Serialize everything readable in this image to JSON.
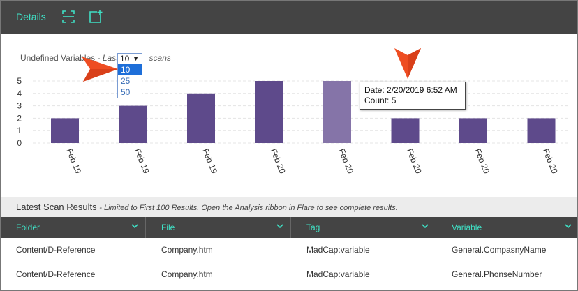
{
  "toolbar": {
    "details_label": "Details",
    "icons": [
      "scan-frame-icon",
      "add-window-icon"
    ],
    "accent_color": "#3fe0c5",
    "background": "#444444"
  },
  "chart": {
    "title_prefix": "Undefined Variables - ",
    "title_italic_prefix": "Last",
    "title_italic_suffix": "scans",
    "select": {
      "value": "10",
      "options": [
        "10",
        "25",
        "50"
      ],
      "highlighted": "10"
    },
    "tooltip": {
      "date_line": "Date: 2/20/2019 6:52 AM",
      "count_line": "Count: 5"
    }
  },
  "chart_data": {
    "type": "bar",
    "categories": [
      "Feb 19",
      "Feb 19",
      "Feb 19",
      "Feb 20",
      "Feb 20",
      "Feb 20",
      "Feb 20",
      "Feb 20"
    ],
    "values": [
      2,
      3,
      4,
      5,
      5,
      2,
      2,
      2
    ],
    "yticks": [
      0,
      1,
      2,
      3,
      4,
      5
    ],
    "ylim": [
      0,
      5
    ],
    "highlighted_index": 4,
    "bar_color": "#5e4a8b",
    "highlight_color": "#8574a8",
    "grid": "horizontal-dashed",
    "xlabel": "",
    "ylabel": ""
  },
  "results": {
    "title": "Latest Scan Results",
    "note": "- Limited to First 100 Results. Open the Analysis ribbon in Flare to see complete results.",
    "columns": [
      "Folder",
      "File",
      "Tag",
      "Variable"
    ],
    "rows": [
      [
        "Content/D-Reference",
        "Company.htm",
        "MadCap:variable",
        "General.CompasnyName"
      ],
      [
        "Content/D-Reference",
        "Company.htm",
        "MadCap:variable",
        "General.PhonseNumber"
      ]
    ]
  }
}
